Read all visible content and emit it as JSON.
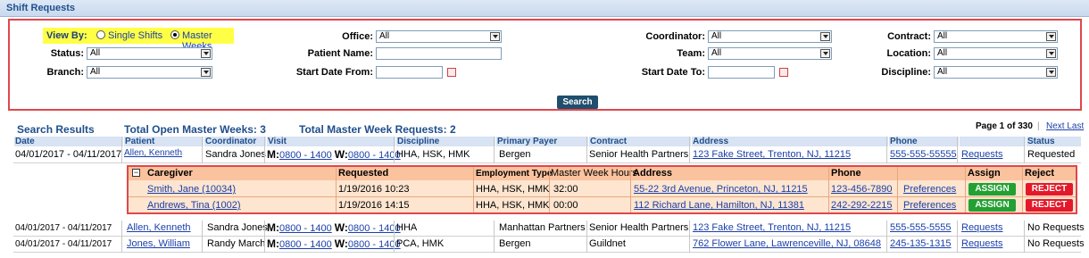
{
  "title": "Shift Requests",
  "filters": {
    "view_by_label": "View By:",
    "single_shifts": "Single Shifts",
    "master_weeks": "Master Weeks",
    "status_label": "Status:",
    "status_value": "All",
    "branch_label": "Branch:",
    "branch_value": "All",
    "office_label": "Office:",
    "office_value": "All",
    "patient_name_label": "Patient Name:",
    "patient_name_value": "",
    "start_from_label": "Start Date From:",
    "start_from_value": "",
    "coordinator_label": "Coordinator:",
    "coordinator_value": "All",
    "team_label": "Team:",
    "team_value": "All",
    "start_to_label": "Start Date To:",
    "start_to_value": "",
    "contract_label": "Contract:",
    "contract_value": "All",
    "location_label": "Location:",
    "location_value": "All",
    "discipline_label": "Discipline:",
    "discipline_value": "All",
    "search_button": "Search"
  },
  "summary": {
    "search_results": "Search Results",
    "open_master_weeks": "Total Open Master Weeks: 3",
    "master_week_requests": "Total Master Week Requests: 2",
    "page": "Page 1 of 330",
    "next_last": "Next Last"
  },
  "columns": [
    "Date",
    "Patient",
    "Coordinator",
    "Visit",
    "Discipline",
    "Primary Payer",
    "Contract",
    "Address",
    "Phone",
    "",
    "Status"
  ],
  "rows": [
    {
      "date": "04/01/2017 - 04/11/2017",
      "patient": "Allen, Kenneth",
      "coordinator": "Sandra Jones",
      "m_label": "M:",
      "m_time": "0800 - 1400",
      "w_label": "W:",
      "w_time": "0800 - 1400",
      "discipline": "HHA, HSK, HMK",
      "payer": "Bergen",
      "contract": "Senior Health Partners",
      "address": "123 Fake Street, Trenton, NJ, 11215",
      "phone": "555-555-55555",
      "requests": "Requests",
      "status": "Requested"
    },
    {
      "date": "04/01/2017 - 04/11/2017",
      "patient": "Allen, Kenneth",
      "coordinator": "Sandra Jones",
      "m_label": "M:",
      "m_time": "0800 - 1400",
      "w_label": "W:",
      "w_time": "0800 - 1400",
      "discipline": "HHA",
      "payer": "Manhattan Partners",
      "contract": "Senior Health Partners",
      "address": "123 Fake Street, Trenton, NJ, 11215",
      "phone": "555-555-5555",
      "requests": "Requests",
      "status": "No Requests"
    },
    {
      "date": "04/01/2017 - 04/11/2017",
      "patient": "Jones, William",
      "coordinator": "Randy March",
      "m_label": "M:",
      "m_time": "0800 - 1400",
      "w_label": "W:",
      "w_time": "0800 - 1400",
      "discipline": "PCA, HMK",
      "payer": "Bergen",
      "contract": "Guildnet",
      "address": "762 Flower Lane, Lawrenceville, NJ, 08648",
      "phone": "245-135-1315",
      "requests": "Requests",
      "status": "No Requests"
    }
  ],
  "sub_columns": [
    "Caregiver",
    "Requested",
    "Employment Type",
    "Master Week Hours",
    "Address",
    "Phone",
    "",
    "Assign",
    "Reject"
  ],
  "sub_rows": [
    {
      "caregiver": "Smith, Jane (10034)",
      "requested": "1/19/2016 10:23",
      "employment": "HHA, HSK, HMK",
      "hours": "32:00",
      "address": "55-22 3rd Avenue, Princeton, NJ, 11215",
      "phone": "123-456-7890",
      "preferences": "Preferences",
      "assign": "ASSIGN",
      "reject": "REJECT"
    },
    {
      "caregiver": "Andrews, Tina (1002)",
      "requested": "1/19/2016 14:15",
      "employment": "HHA, HSK, HMK",
      "hours": "00:00",
      "address": "112 Richard Lane, Hamilton, NJ, 11381",
      "phone": "242-292-2215",
      "preferences": "Preferences",
      "assign": "ASSIGN",
      "reject": "REJECT"
    }
  ],
  "colors": {
    "highlight": "#ffff46",
    "frame": "#e0474c",
    "assign": "#22a032",
    "reject": "#e3192a",
    "header": "#1f4e8c"
  }
}
